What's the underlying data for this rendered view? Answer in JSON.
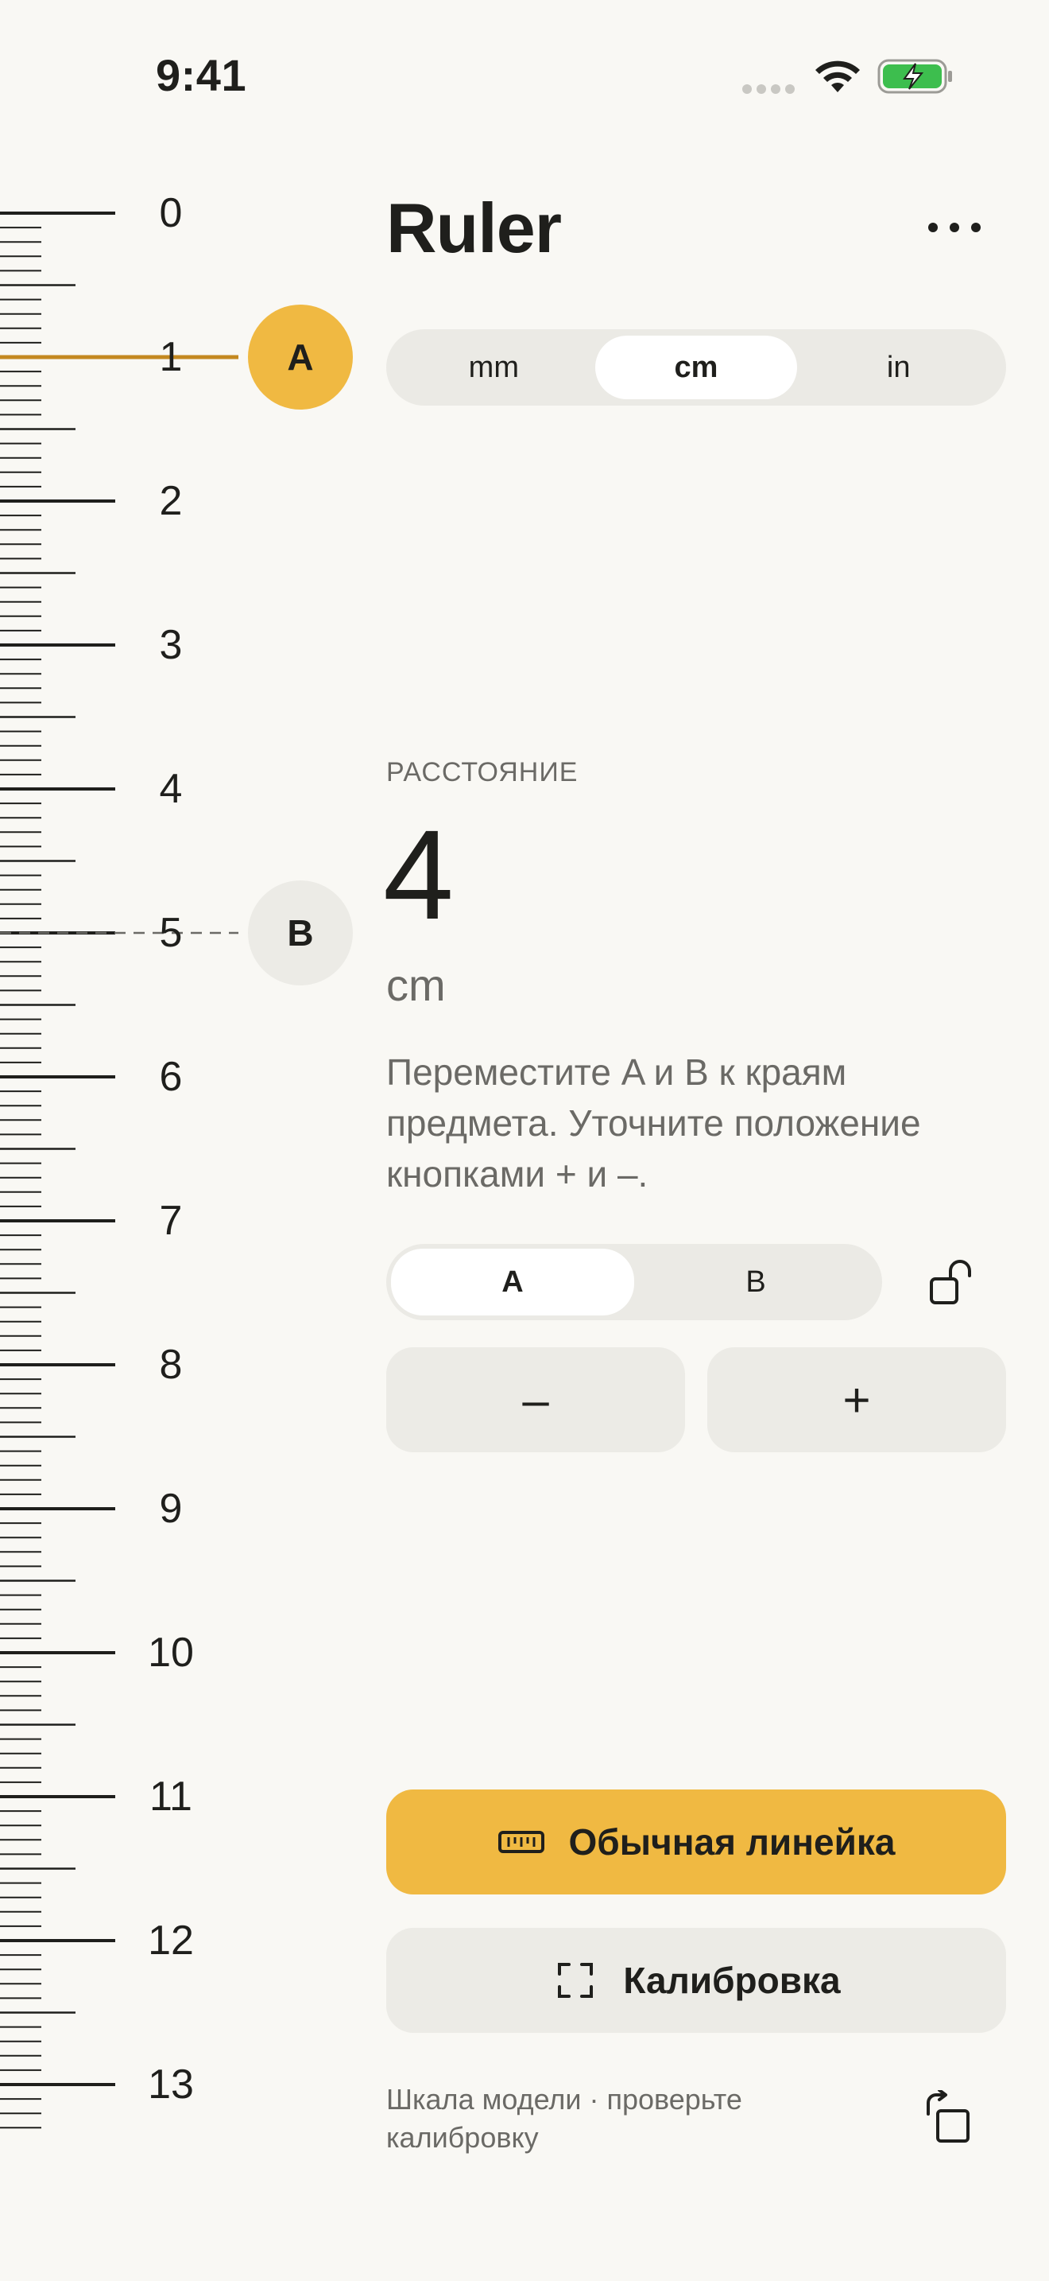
{
  "status_bar": {
    "time": "9:41",
    "signal_icon": "signal-dots-icon",
    "wifi_icon": "wifi-icon",
    "battery_icon": "battery-charging-icon",
    "battery_color": "#3dbe4e"
  },
  "ruler": {
    "labels": [
      "0",
      "1",
      "2",
      "3",
      "4",
      "5",
      "6",
      "7",
      "8",
      "9",
      "10",
      "11",
      "12",
      "13"
    ],
    "handle_a": {
      "label": "A",
      "value_cm": 1,
      "color": "#f0b942"
    },
    "handle_b": {
      "label": "B",
      "value_cm": 5,
      "color": "#ecebe6"
    }
  },
  "header": {
    "title": "Ruler",
    "more_icon": "more-horizontal-icon"
  },
  "units": {
    "options": [
      "mm",
      "cm",
      "in"
    ],
    "selected": "cm"
  },
  "measurement": {
    "label": "РАССТОЯНИЕ",
    "value": "4",
    "unit": "cm",
    "hint": "Переместите A и B к краям предмета. Уточните положение кнопками + и –."
  },
  "point_selector": {
    "options": [
      "A",
      "B"
    ],
    "selected": "A",
    "lock_icon": "unlock-icon"
  },
  "steppers": {
    "minus_label": "–",
    "plus_label": "+"
  },
  "actions": {
    "primary_label": "Обычная линейка",
    "primary_icon": "ruler-icon",
    "secondary_label": "Калибровка",
    "secondary_icon": "calibration-frame-icon"
  },
  "footer": {
    "note": "Шкала модели · проверьте калибровку",
    "rotate_icon": "rotate-icon"
  },
  "colors": {
    "accent": "#f0b942",
    "accent_line": "#c4881f",
    "background": "#f9f8f4",
    "control_bg": "#ebeae5"
  }
}
